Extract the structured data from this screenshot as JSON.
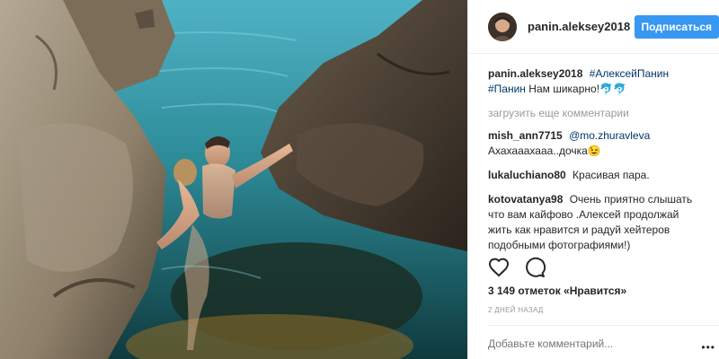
{
  "header": {
    "username": "panin.aleksey2018",
    "follow_label": "Подписаться"
  },
  "caption": {
    "username": "panin.aleksey2018",
    "tag1": "#АлексейПанин",
    "tag2": "#Панин",
    "text": "Нам шикарно!",
    "emoji": "🐬🐬"
  },
  "load_more": "загрузить еще комментарии",
  "comments": [
    {
      "username": "mish_ann7715",
      "mention": "@mo.zhuravleva",
      "text": "Ахахааахааа..дочка😉"
    },
    {
      "username": "lukaluchiano80",
      "text": "Красивая пара."
    },
    {
      "username": "kotovatanya98",
      "text": "Очень приятно слышать что вам кайфово .Алексей продолжай жить как нравится и радуй хейтеров подобными фотографиями!)"
    }
  ],
  "likes": "3 149 отметок «Нравится»",
  "time": "2 дней назад",
  "comment_input": {
    "placeholder": "Добавьте комментарий..."
  },
  "more_dots": "•••",
  "icons": {
    "like": "heart-icon",
    "comment": "comment-bubble-icon",
    "more": "more-dots-icon"
  },
  "colors": {
    "follow_button": "#3897f0",
    "hashtag": "#003569",
    "muted": "#999999"
  }
}
